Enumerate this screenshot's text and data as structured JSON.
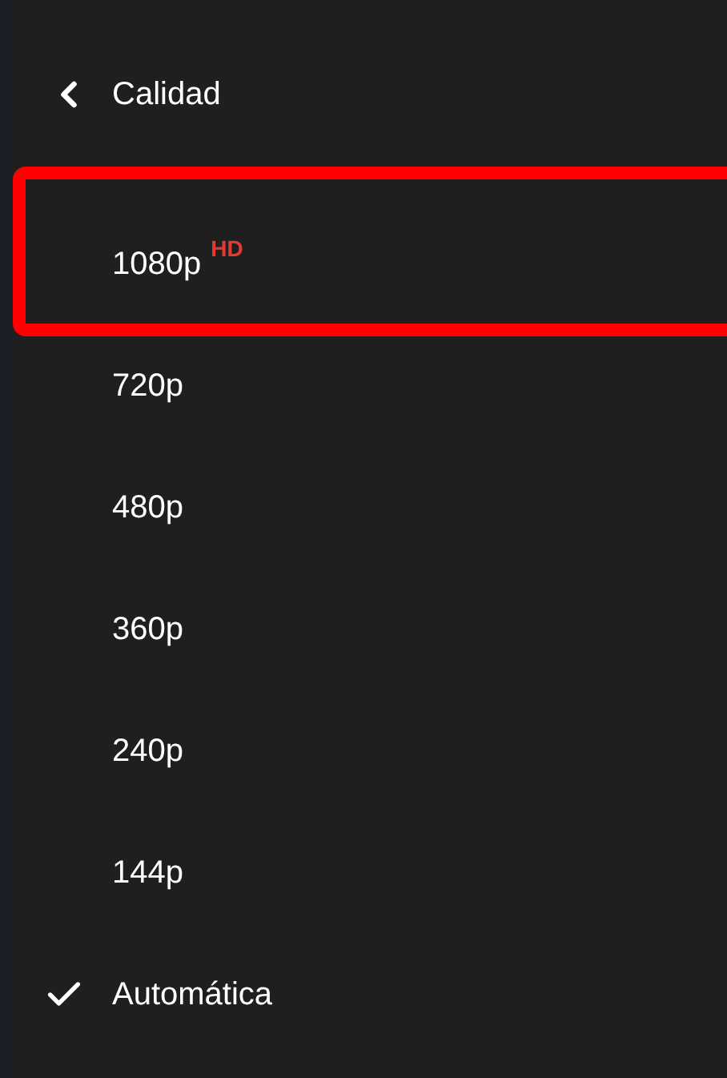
{
  "header": {
    "title": "Calidad"
  },
  "options": [
    {
      "label": "1080p",
      "badge": "HD",
      "selected": false,
      "highlighted": true
    },
    {
      "label": "720p",
      "selected": false,
      "highlighted": false
    },
    {
      "label": "480p",
      "selected": false,
      "highlighted": false
    },
    {
      "label": "360p",
      "selected": false,
      "highlighted": false
    },
    {
      "label": "240p",
      "selected": false,
      "highlighted": false
    },
    {
      "label": "144p",
      "selected": false,
      "highlighted": false
    },
    {
      "label": "Automática",
      "selected": true,
      "highlighted": false
    }
  ]
}
